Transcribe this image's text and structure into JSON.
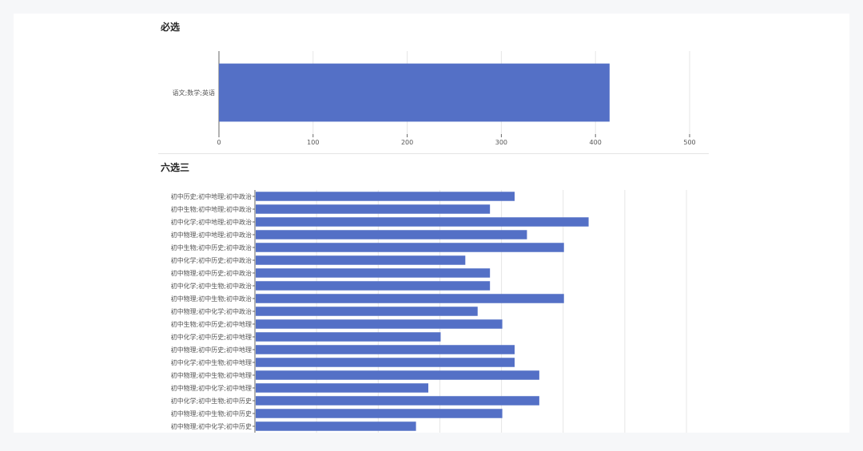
{
  "sections": [
    {
      "title": "必选"
    },
    {
      "title": "六选三"
    }
  ],
  "colors": {
    "bar": "#5470c6",
    "grid": "#e6e6e6",
    "axis": "#666666"
  },
  "chart_data": [
    {
      "type": "bar",
      "orientation": "horizontal",
      "title": "必选",
      "categories": [
        "语文;数学;英语"
      ],
      "values": [
        415
      ],
      "xlim": [
        0,
        500
      ],
      "xticks": [
        0,
        100,
        200,
        300,
        400,
        500
      ],
      "grid": true
    },
    {
      "type": "bar",
      "orientation": "horizontal",
      "title": "六选三",
      "categories": [
        "初中历史;初中地理;初中政治",
        "初中生物;初中地理;初中政治",
        "初中化学;初中地理;初中政治",
        "初中物理;初中地理;初中政治",
        "初中生物;初中历史;初中政治",
        "初中化学;初中历史;初中政治",
        "初中物理;初中历史;初中政治",
        "初中化学;初中生物;初中政治",
        "初中物理;初中生物;初中政治",
        "初中物理;初中化学;初中政治",
        "初中生物;初中历史;初中地理",
        "初中化学;初中历史;初中地理",
        "初中物理;初中历史;初中地理",
        "初中化学;初中生物;初中地理",
        "初中物理;初中生物;初中地理",
        "初中物理;初中化学;初中地理",
        "初中化学;初中生物;初中历史",
        "初中物理;初中生物;初中历史",
        "初中物理;初中化学;初中历史"
      ],
      "values": [
        210,
        190,
        270,
        220,
        250,
        170,
        190,
        190,
        250,
        180,
        200,
        150,
        210,
        210,
        230,
        140,
        230,
        200,
        130
      ],
      "grid": true
    }
  ]
}
